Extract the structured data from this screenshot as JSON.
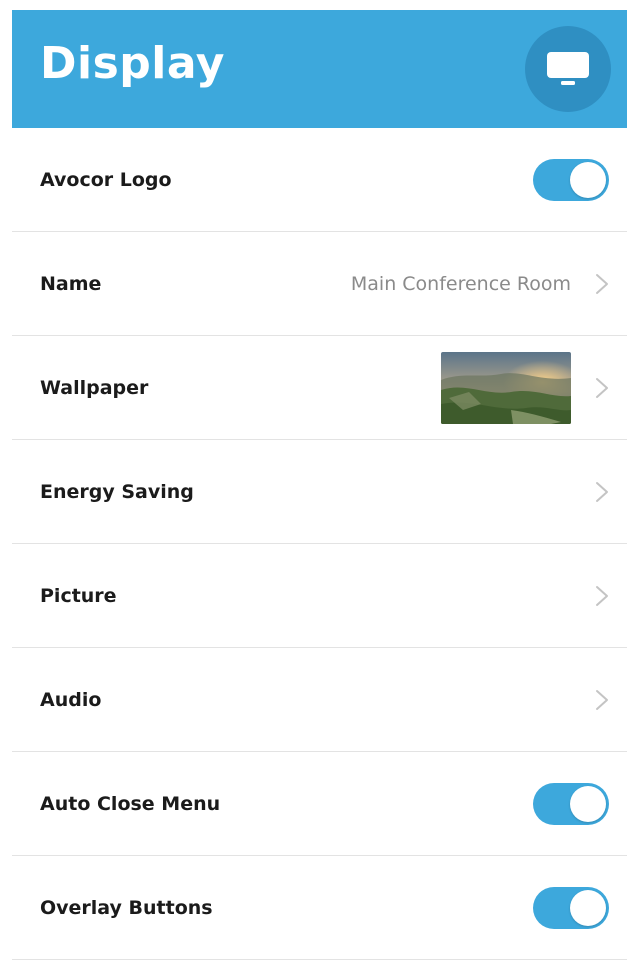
{
  "header": {
    "title": "Display",
    "icon": "monitor-icon",
    "color": "#3da8dc",
    "icon_bg_color": "#2f8fc2"
  },
  "settings": [
    {
      "label": "Avocor Logo",
      "control": "toggle",
      "on": true
    },
    {
      "label": "Name",
      "control": "chevron",
      "value": "Main Conference Room"
    },
    {
      "label": "Wallpaper",
      "control": "chevron",
      "value_image": "landscape-thumbnail"
    },
    {
      "label": "Energy Saving",
      "control": "chevron"
    },
    {
      "label": "Picture",
      "control": "chevron"
    },
    {
      "label": "Audio",
      "control": "chevron"
    },
    {
      "label": "Auto Close Menu",
      "control": "toggle",
      "on": true
    },
    {
      "label": "Overlay Buttons",
      "control": "toggle",
      "on": true
    }
  ],
  "colors": {
    "accent": "#3da8dc",
    "divider": "#e3e3e3",
    "value_text": "#8a8a8a",
    "chevron": "#c4c4c4"
  }
}
